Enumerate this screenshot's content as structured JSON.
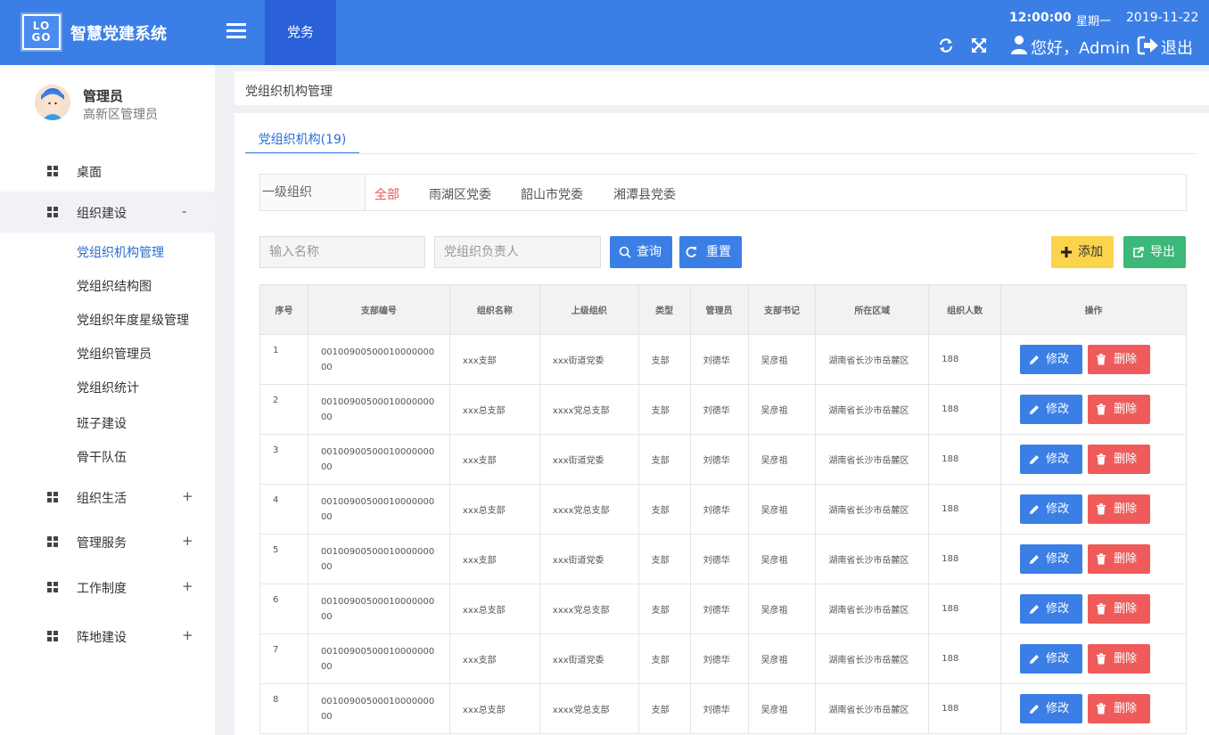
{
  "header": {
    "logo_line1": "LO",
    "logo_line2": "GO",
    "system_title": "智慧党建系统",
    "nav_tab": "党务",
    "time": "12:00:00",
    "weekday": "星期一",
    "date": "2019-11-22",
    "greeting": "您好，Admin",
    "logout": "退出",
    "accent": "#3b7fe6"
  },
  "user": {
    "name": "管理员",
    "role": "高新区管理员"
  },
  "sidebar": {
    "items": [
      {
        "label": "桌面",
        "sign": ""
      },
      {
        "label": "组织建设",
        "sign": "-"
      },
      {
        "label": "组织生活",
        "sign": "+"
      },
      {
        "label": "管理服务",
        "sign": "+"
      },
      {
        "label": "工作制度",
        "sign": "+"
      },
      {
        "label": "阵地建设",
        "sign": "+"
      }
    ],
    "sub_items": [
      "党组织机构管理",
      "党组织结构图",
      "党组织年度星级管理",
      "党组织管理员",
      "党组织统计",
      "班子建设",
      "骨干队伍"
    ]
  },
  "page": {
    "breadcrumb": "党组织机构管理",
    "tab": "党组织机构(19)"
  },
  "filter": {
    "label": "一级组织",
    "options": [
      "全部",
      "雨湖区党委",
      "韶山市党委",
      "湘潭县党委"
    ]
  },
  "search": {
    "name_placeholder": "输入名称",
    "leader_placeholder": "党组织负责人",
    "query": "查询",
    "reset": "重置",
    "add": "添加",
    "export": "导出"
  },
  "table": {
    "headers": [
      "序号",
      "支部编号",
      "组织名称",
      "上级组织",
      "类型",
      "管理员",
      "支部书记",
      "所在区域",
      "组织人数",
      "操作"
    ],
    "edit_label": "修改",
    "delete_label": "删除",
    "rows": [
      {
        "seq": "1",
        "code1": "00100900500010000000",
        "code2": "00",
        "name": "xxx支部",
        "parent": "xxx街道党委",
        "type": "支部",
        "admin": "刘德华",
        "secretary": "吴彦祖",
        "region": "湖南省长沙市岳麓区",
        "count": "188"
      },
      {
        "seq": "2",
        "code1": "00100900500010000000",
        "code2": "00",
        "name": "xxx总支部",
        "parent": "xxxx党总支部",
        "type": "支部",
        "admin": "刘德华",
        "secretary": "吴彦祖",
        "region": "湖南省长沙市岳麓区",
        "count": "188"
      },
      {
        "seq": "3",
        "code1": "00100900500010000000",
        "code2": "00",
        "name": "xxx支部",
        "parent": "xxx街道党委",
        "type": "支部",
        "admin": "刘德华",
        "secretary": "吴彦祖",
        "region": "湖南省长沙市岳麓区",
        "count": "188"
      },
      {
        "seq": "4",
        "code1": "00100900500010000000",
        "code2": "00",
        "name": "xxx总支部",
        "parent": "xxxx党总支部",
        "type": "支部",
        "admin": "刘德华",
        "secretary": "吴彦祖",
        "region": "湖南省长沙市岳麓区",
        "count": "188"
      },
      {
        "seq": "5",
        "code1": "00100900500010000000",
        "code2": "00",
        "name": "xxx支部",
        "parent": "xxx街道党委",
        "type": "支部",
        "admin": "刘德华",
        "secretary": "吴彦祖",
        "region": "湖南省长沙市岳麓区",
        "count": "188"
      },
      {
        "seq": "6",
        "code1": "00100900500010000000",
        "code2": "00",
        "name": "xxx总支部",
        "parent": "xxxx党总支部",
        "type": "支部",
        "admin": "刘德华",
        "secretary": "吴彦祖",
        "region": "湖南省长沙市岳麓区",
        "count": "188"
      },
      {
        "seq": "7",
        "code1": "00100900500010000000",
        "code2": "00",
        "name": "xxx支部",
        "parent": "xxx街道党委",
        "type": "支部",
        "admin": "刘德华",
        "secretary": "吴彦祖",
        "region": "湖南省长沙市岳麓区",
        "count": "188"
      },
      {
        "seq": "8",
        "code1": "00100900500010000000",
        "code2": "00",
        "name": "xxx总支部",
        "parent": "xxxx党总支部",
        "type": "支部",
        "admin": "刘德华",
        "secretary": "吴彦祖",
        "region": "湖南省长沙市岳麓区",
        "count": "188"
      }
    ]
  }
}
